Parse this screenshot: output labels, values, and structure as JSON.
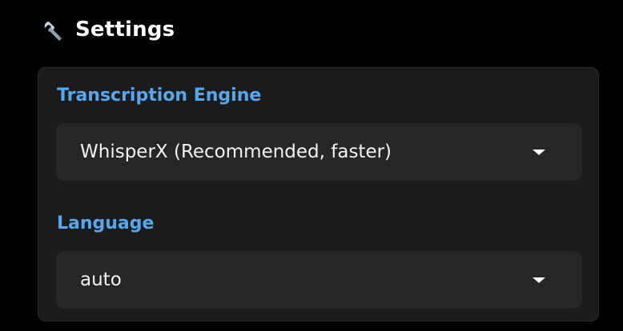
{
  "header": {
    "title": "Settings",
    "icon": "wrench-icon"
  },
  "settings": {
    "engine": {
      "label": "Transcription Engine",
      "selected": "WhisperX (Recommended, faster)"
    },
    "language": {
      "label": "Language",
      "selected": "auto"
    }
  },
  "colors": {
    "background": "#000000",
    "panel": "#1b1b1b",
    "select": "#262626",
    "label_accent": "#55a8ef"
  }
}
